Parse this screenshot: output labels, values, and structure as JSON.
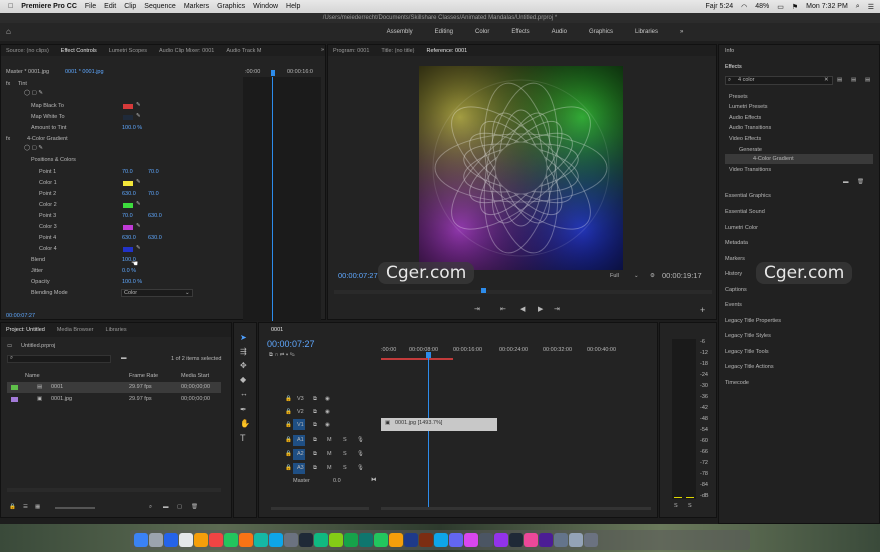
{
  "menubar": {
    "app": "Premiere Pro CC",
    "items": [
      "File",
      "Edit",
      "Clip",
      "Sequence",
      "Markers",
      "Graphics",
      "Window",
      "Help"
    ],
    "prayer": "Fajr 5:24",
    "battery": "48%",
    "clock": "Mon 7:32 PM"
  },
  "title_path": "/Users/meiederrecht/Documents/Skillshare Classes/Animated Mandalas/Untitled.prproj *",
  "workspaces": [
    "Assembly",
    "Editing",
    "Color",
    "Effects",
    "Audio",
    "Graphics",
    "Libraries"
  ],
  "effect_controls": {
    "tabs": [
      "Source: (no clips)",
      "Effect Controls",
      "Lumetri Scopes",
      "Audio Clip Mixer: 0001",
      "Audio Track M"
    ],
    "master": "Master * 0001.jpg",
    "clip": "0001 * 0001.jpg",
    "tl_start": ":00:00",
    "tl_end": "00:00:16:0",
    "tint": "Tint",
    "map_black": "Map Black To",
    "map_white": "Map White To",
    "amount_tint": "Amount to Tint",
    "amount_tint_val": "100.0 %",
    "gradient": "4-Color Gradient",
    "positions": "Positions & Colors",
    "point1": "Point 1",
    "p1x": "70.0",
    "p1y": "70.0",
    "color1": "Color 1",
    "point2": "Point 2",
    "p2x": "630.0",
    "p2y": "70.0",
    "color2": "Color 2",
    "point3": "Point 3",
    "p3x": "70.0",
    "p3y": "630.0",
    "color3": "Color 3",
    "point4": "Point 4",
    "p4x": "630.0",
    "p4y": "630.0",
    "color4": "Color 4",
    "blend": "Blend",
    "blend_val": "100.0",
    "jitter": "Jitter",
    "jitter_val": "0.0 %",
    "opacity": "Opacity",
    "opacity_val": "100.0 %",
    "blending_mode": "Blending Mode",
    "blending_mode_val": "Color",
    "timecode": "00:00:07:27"
  },
  "program": {
    "tabs": [
      "Program: 0001",
      "Title: (no title)",
      "Reference: 0001"
    ],
    "timecode": "00:00:07:27",
    "fit": "Full",
    "duration": "00:00:19:17"
  },
  "watermark": "Cger.com",
  "effects": {
    "info": "Info",
    "title": "Effects",
    "search": "4 color",
    "tree": [
      "Presets",
      "Lumetri Presets",
      "Audio Effects",
      "Audio Transitions",
      "Video Effects",
      "Generate",
      "4-Color Gradient",
      "Video Transitions"
    ],
    "panels": [
      "Essential Graphics",
      "Essential Sound",
      "Lumetri Color",
      "Metadata",
      "Markers",
      "History",
      "Captions",
      "Events",
      "Legacy Title Properties",
      "Legacy Title Styles",
      "Legacy Title Tools",
      "Legacy Title Actions",
      "Timecode"
    ]
  },
  "project": {
    "tabs": [
      "Project: Untitled",
      "Media Browser",
      "Libraries"
    ],
    "file": "Untitled.prproj",
    "selected": "1 of 2 items selected",
    "cols": [
      "Name",
      "Frame Rate",
      "Media Start"
    ],
    "rows": [
      {
        "name": "0001",
        "rate": "29.97 fps",
        "start": "00;00;00;00"
      },
      {
        "name": "0001.jpg",
        "rate": "29.97 fps",
        "start": "00;00;00;00"
      }
    ]
  },
  "timeline": {
    "tab": "0001",
    "timecode": "00:00:07:27",
    "ruler": [
      ":00:00",
      "00:00:08:00",
      "00:00:16:00",
      "00:00:24:00",
      "00:00:32:00",
      "00:00:40:00"
    ],
    "tracks": [
      "V3",
      "V2",
      "V1",
      "A1",
      "A2",
      "A3"
    ],
    "master": "Master",
    "master_val": "0.0",
    "clip": "0001.jpg [1493.7%]"
  },
  "meter": {
    "labels": [
      "-6",
      "-12",
      "-18",
      "-24",
      "-30",
      "-36",
      "-42",
      "-48",
      "-54",
      "-60",
      "-66",
      "-72",
      "-78",
      "-84",
      "-dB"
    ],
    "solo": [
      "S",
      "S"
    ]
  },
  "colors": {
    "color1": "#f2e63a",
    "color2": "#3ddc3d",
    "color3": "#c03ad6",
    "color4": "#2233c8",
    "mapblack": "#d63a3a",
    "mapwhite": "#1f2a3a",
    "accent": "#2d8ceb"
  }
}
